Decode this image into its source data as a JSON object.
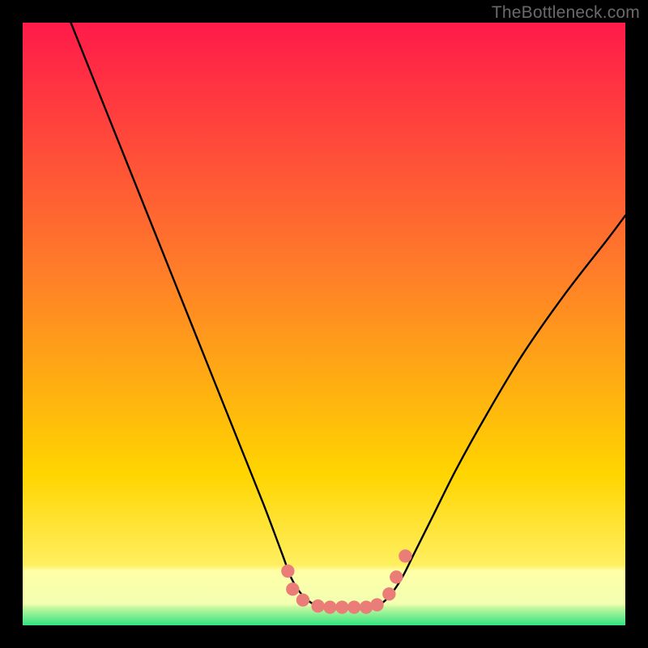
{
  "watermark": "TheBottleneck.com",
  "chart_data": {
    "type": "line",
    "title": "",
    "xlabel": "",
    "ylabel": "",
    "xlim": [
      0,
      100
    ],
    "ylim": [
      0,
      100
    ],
    "grid": false,
    "legend": false,
    "background_gradient": {
      "top_color": "#ff1a4a",
      "mid_color": "#ffd500",
      "bottom_band_color": "#ffffa8",
      "bottom_edge_color": "#2fe480"
    },
    "series": [
      {
        "name": "left-curve",
        "color": "#000000",
        "x": [
          8,
          12,
          16,
          20,
          24,
          28,
          32,
          36,
          40,
          43,
          44.5,
          46,
          47.5,
          49,
          50
        ],
        "y": [
          100,
          90,
          80,
          70,
          60,
          50,
          40,
          30,
          20,
          12,
          8,
          5.5,
          4,
          3.2,
          3
        ]
      },
      {
        "name": "right-curve",
        "color": "#000000",
        "x": [
          58,
          59.5,
          61,
          63,
          65,
          68,
          72,
          77,
          83,
          90,
          97,
          100
        ],
        "y": [
          3,
          3.6,
          5,
          8,
          12,
          18,
          26,
          35,
          45,
          55,
          64,
          68
        ]
      },
      {
        "name": "floor",
        "color": "#000000",
        "x": [
          50,
          52,
          54,
          56,
          58
        ],
        "y": [
          3,
          3,
          3,
          3,
          3
        ]
      }
    ],
    "markers": {
      "name": "highlight-dots",
      "color": "#eb7d78",
      "radius_norm": 1.1,
      "points_xy": [
        [
          44.0,
          9.0
        ],
        [
          44.8,
          6.0
        ],
        [
          46.5,
          4.2
        ],
        [
          49.0,
          3.2
        ],
        [
          51.0,
          3.0
        ],
        [
          53.0,
          3.0
        ],
        [
          55.0,
          3.0
        ],
        [
          57.0,
          3.0
        ],
        [
          58.8,
          3.4
        ],
        [
          60.8,
          5.2
        ],
        [
          62.0,
          8.0
        ],
        [
          63.5,
          11.5
        ]
      ]
    }
  }
}
